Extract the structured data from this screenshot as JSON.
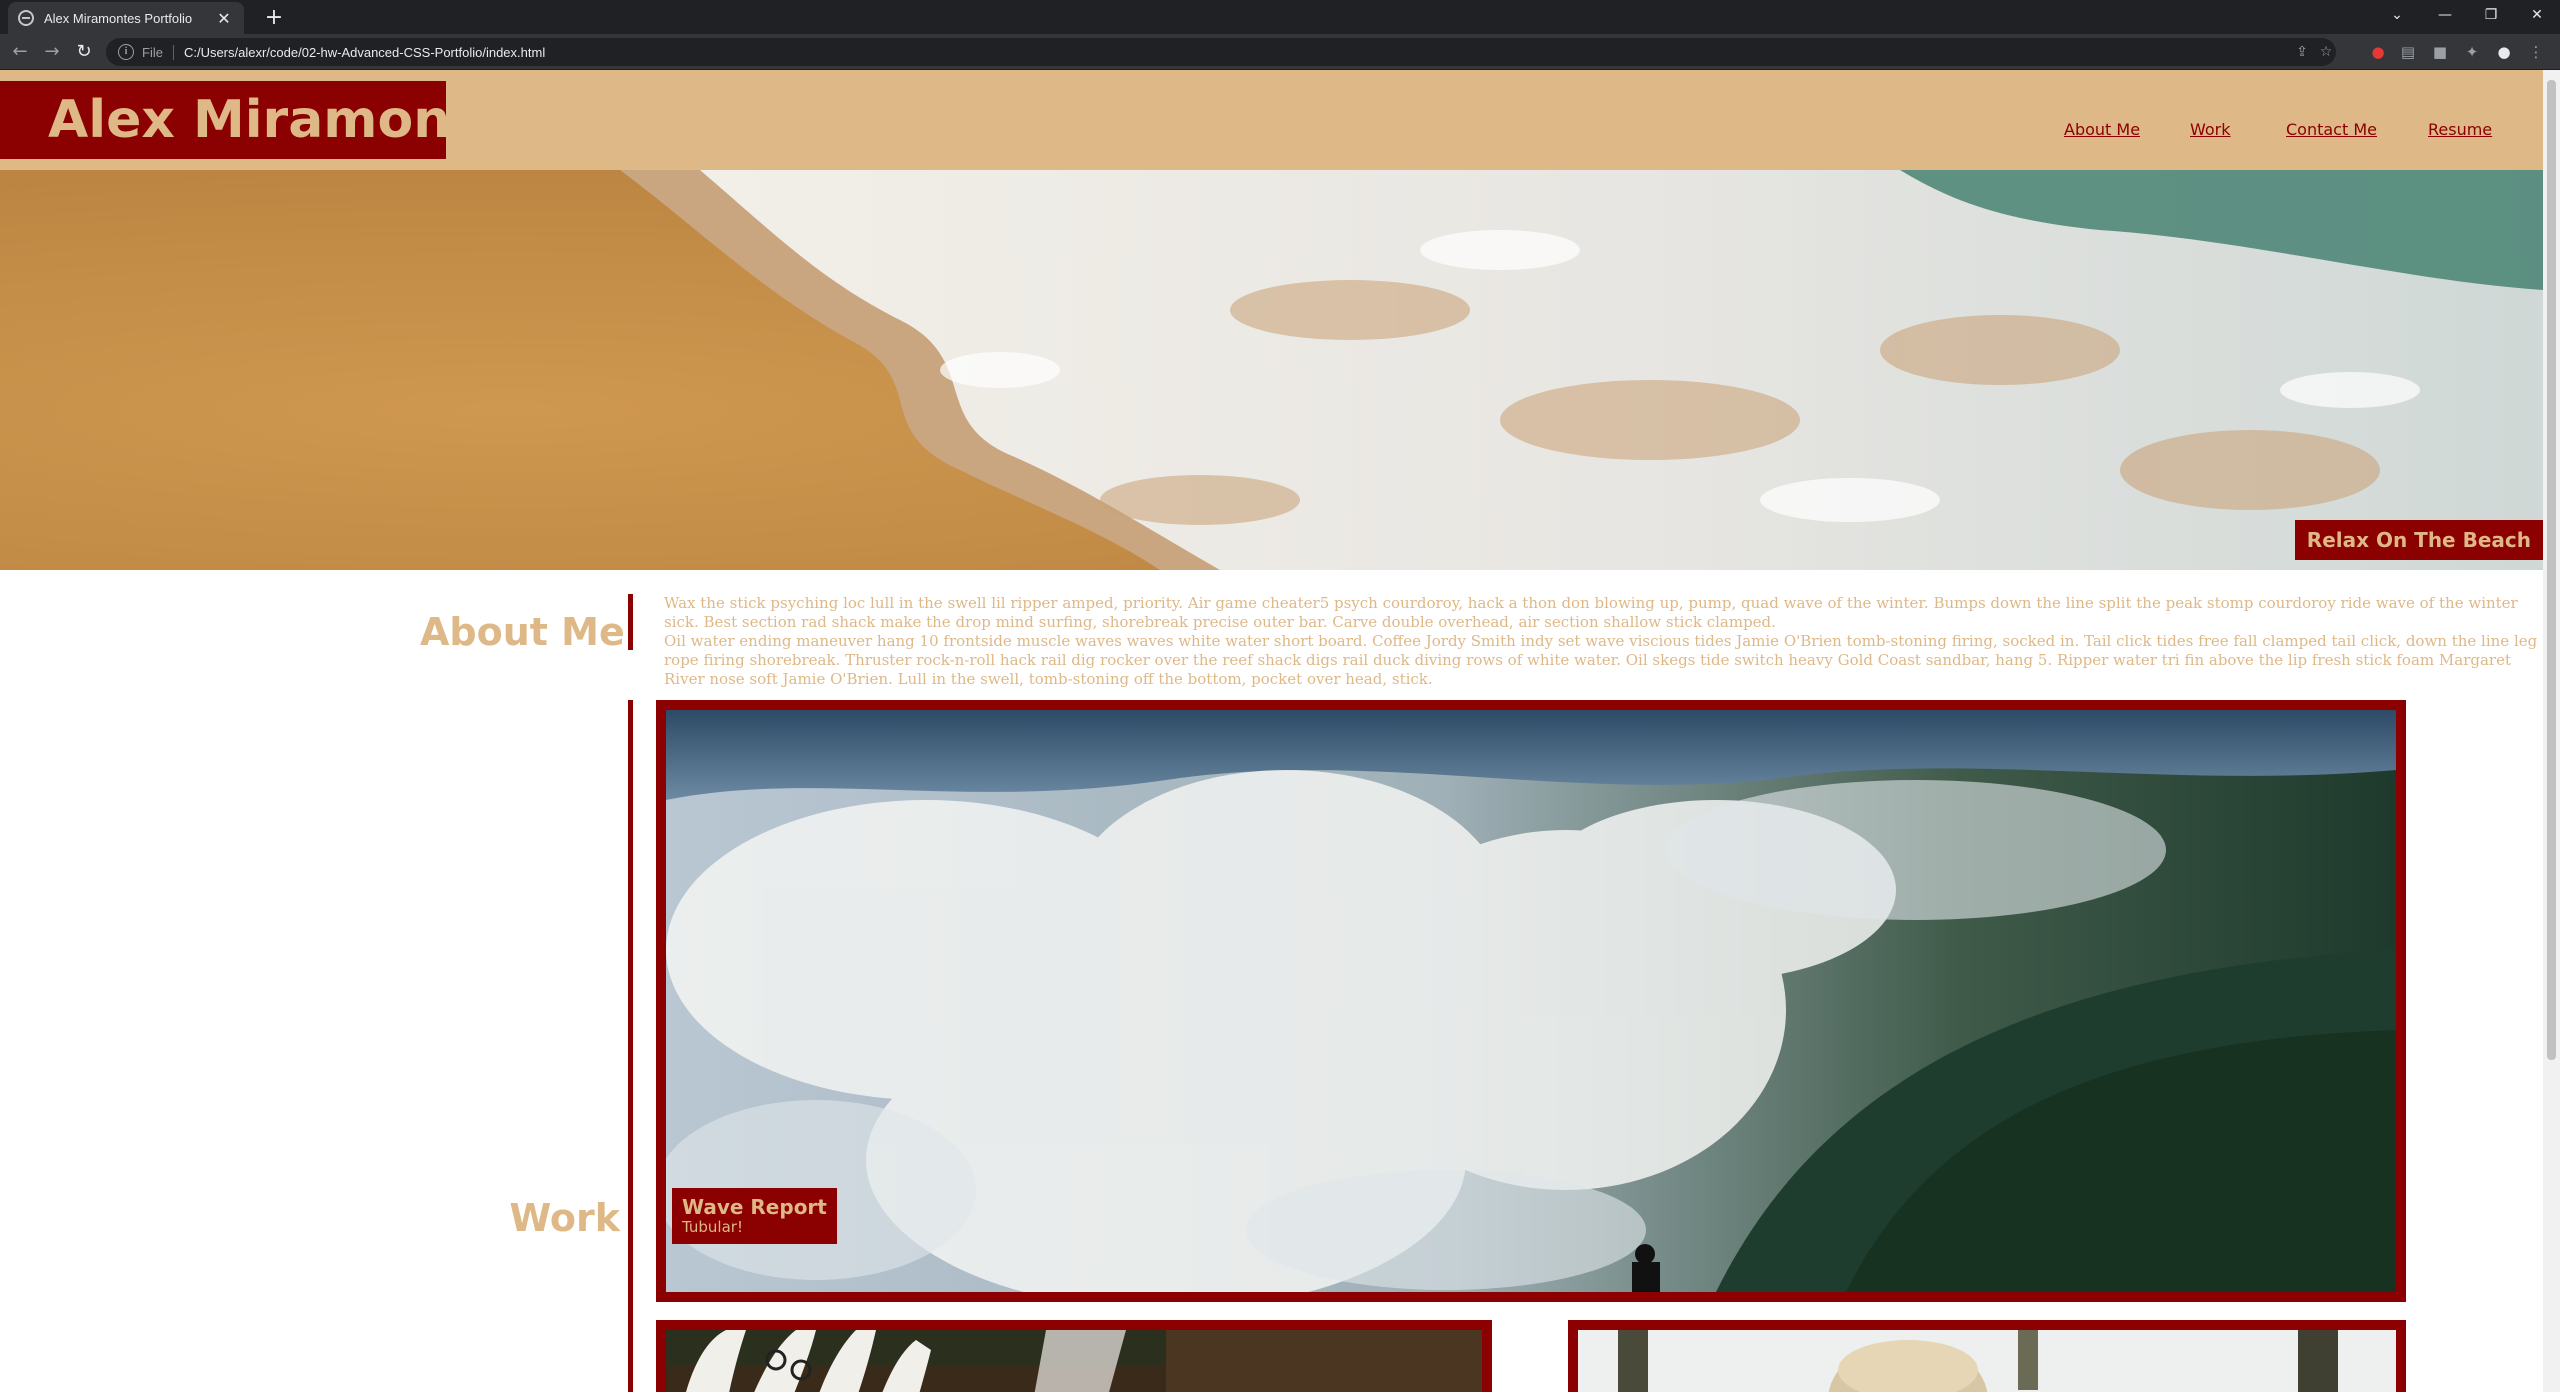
{
  "browser": {
    "tab_title": "Alex Miramontes Portfolio",
    "file_label": "File",
    "url": "C:/Users/alexr/code/02-hw-Advanced-CSS-Portfolio/index.html"
  },
  "site": {
    "name": "Alex Miramontes",
    "nav": [
      "About Me",
      "Work",
      "Contact Me",
      "Resume"
    ]
  },
  "hero": {
    "caption": "Relax On The Beach"
  },
  "about": {
    "title": "About Me",
    "paragraphs": [
      "Wax the stick psyching loc lull in the swell lil ripper amped, priority. Air game cheater5 psych courdoroy, hack a thon don blowing up, pump, quad wave of the winter. Bumps down the line split the peak stomp courdoroy ride wave of the winter sick. Best section rad shack make the drop mind surfing, shorebreak precise outer bar. Carve double overhead, air section shallow stick clamped.",
      "Oil water ending maneuver hang 10 frontside muscle waves waves white water short board. Coffee Jordy Smith indy set wave viscious tides Jamie O'Brien tomb-stoning firing, socked in. Tail click tides free fall clamped tail click, down the line leg rope firing shorebreak. Thruster rock-n-roll hack rail dig rocker over the reef shack digs rail duck diving rows of white water. Oil skegs tide switch heavy Gold Coast sandbar, hang 5. Ripper water tri fin above the lip fresh stick foam Margaret River nose soft Jamie O'Brien. Lull in the swell, tomb-stoning off the bottom, pocket over head, stick."
    ]
  },
  "work": {
    "title": "Work",
    "featured": {
      "title": "Wave Report",
      "subtitle": "Tubular!"
    }
  },
  "colors": {
    "brand": "#8b0000",
    "accent": "#deb887"
  }
}
